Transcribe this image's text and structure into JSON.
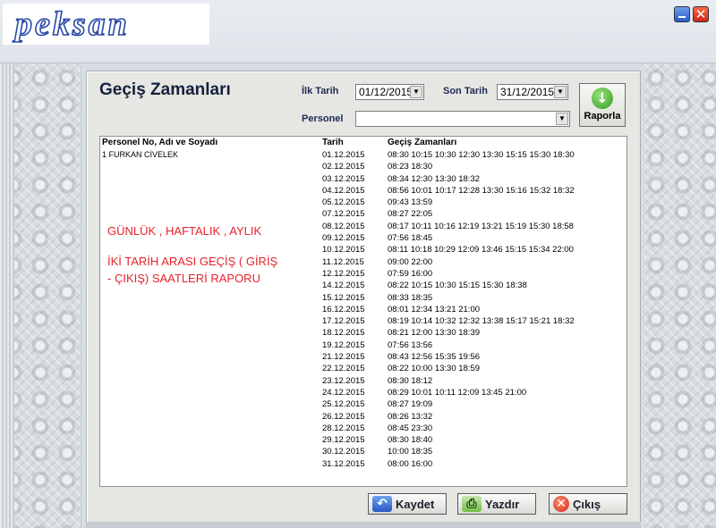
{
  "header": {
    "logo_text": "peksan"
  },
  "window_controls": {
    "minimize": "–",
    "close": "✕"
  },
  "form": {
    "title": "Geçiş Zamanları",
    "start_date_label": "İlk Tarih",
    "start_date_value": "01/12/2015",
    "end_date_label": "Son Tarih",
    "end_date_value": "31/12/2015",
    "personel_label": "Personel",
    "personel_value": "",
    "report_button": "Raporla"
  },
  "report": {
    "columns": [
      "Personel No, Adı ve Soyadı",
      "Tarih",
      "Geçiş Zamanları"
    ],
    "person": "1 FURKAN CİVELEK",
    "rows": [
      {
        "date": "01.12.2015",
        "times": "08:30 10:15 10:30 12:30 13:30 15:15 15:30 18:30"
      },
      {
        "date": "02.12.2015",
        "times": "08:23 18:30"
      },
      {
        "date": "03.12.2015",
        "times": "08:34 12:30 13:30 18:32"
      },
      {
        "date": "04.12.2015",
        "times": "08:56 10:01 10:17 12:28 13:30 15:16 15:32 18:32"
      },
      {
        "date": "05.12.2015",
        "times": "09:43 13:59"
      },
      {
        "date": "07.12.2015",
        "times": "08:27 22:05"
      },
      {
        "date": "08.12.2015",
        "times": "08:17 10:11 10:16 12:19 13:21 15:19 15:30 18:58"
      },
      {
        "date": "09.12.2015",
        "times": "07:56 18:45"
      },
      {
        "date": "10.12.2015",
        "times": "08:11 10:18 10:29 12:09 13:46 15:15 15:34 22:00"
      },
      {
        "date": "11.12.2015",
        "times": "09:00 22:00"
      },
      {
        "date": "12.12.2015",
        "times": "07:59 16:00"
      },
      {
        "date": "14.12.2015",
        "times": "08:22 10:15 10:30 15:15 15:30 18:38"
      },
      {
        "date": "15.12.2015",
        "times": "08:33 18:35"
      },
      {
        "date": "16.12.2015",
        "times": "08:01 12:34 13:21 21:00"
      },
      {
        "date": "17.12.2015",
        "times": "08:19 10:14 10:32 12:32 13:38 15:17 15:21 18:32"
      },
      {
        "date": "18.12.2015",
        "times": "08:21 12:00 13:30 18:39"
      },
      {
        "date": "19.12.2015",
        "times": "07:56 13:56"
      },
      {
        "date": "21.12.2015",
        "times": "08:43 12:56 15:35 19:56"
      },
      {
        "date": "22.12.2015",
        "times": "08:22 10:00 13:30 18:59"
      },
      {
        "date": "23.12.2015",
        "times": "08:30 18:12"
      },
      {
        "date": "24.12.2015",
        "times": "08:29 10:01 10:11 12:09 13:45 21:00"
      },
      {
        "date": "25.12.2015",
        "times": "08:27 19:09"
      },
      {
        "date": "26.12.2015",
        "times": "08:26 13:32"
      },
      {
        "date": "28.12.2015",
        "times": "08:45 23:30"
      },
      {
        "date": "29.12.2015",
        "times": "08:30 18:40"
      },
      {
        "date": "30.12.2015",
        "times": "10:00 18:35"
      },
      {
        "date": "31.12.2015",
        "times": "08:00 16:00"
      }
    ],
    "note_line1": "GÜNLÜK , HAFTALIK , AYLIK",
    "note_line2": "İKİ TARİH ARASI GEÇİŞ ( GİRİŞ",
    "note_line3": "- ÇIKIŞ) SAATLERİ RAPORU"
  },
  "buttons": {
    "save": "Kaydet",
    "print": "Yazdır",
    "exit": "Çıkış"
  },
  "colors": {
    "accent": "#2c4aa8",
    "note": "#e8212c"
  }
}
